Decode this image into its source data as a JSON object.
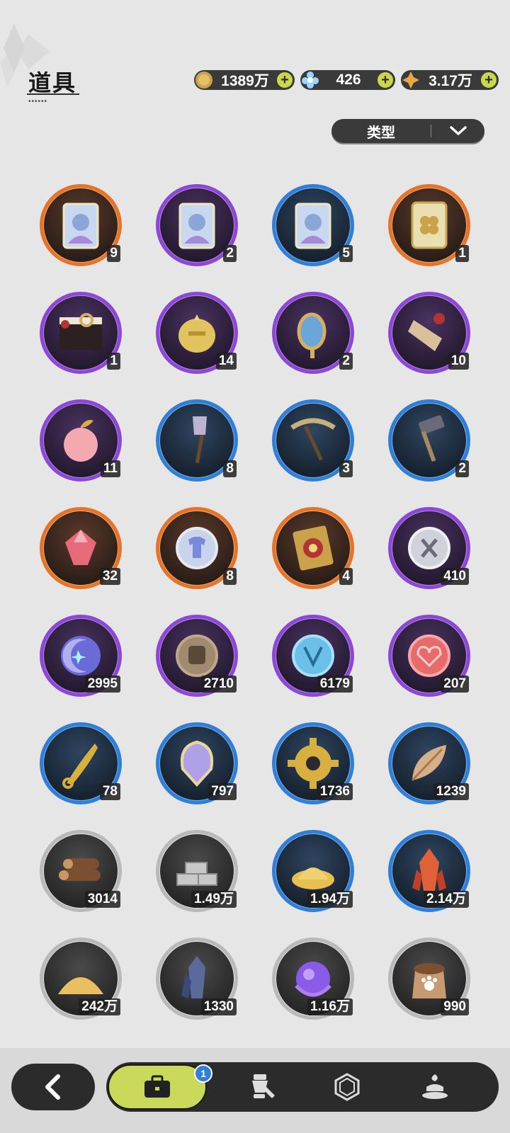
{
  "header": {
    "title": "道具",
    "currencies": [
      {
        "icon": "gold-coin-icon",
        "value": "1389万"
      },
      {
        "icon": "crystal-flower-icon",
        "value": "426"
      },
      {
        "icon": "star-gem-icon",
        "value": "3.17万"
      }
    ]
  },
  "filter": {
    "label": "类型"
  },
  "items": [
    {
      "icon": "character-card-icon",
      "count": "9",
      "rarity": "orange"
    },
    {
      "icon": "character-card-icon",
      "count": "2",
      "rarity": "purple"
    },
    {
      "icon": "character-card-icon",
      "count": "5",
      "rarity": "blue"
    },
    {
      "icon": "clover-ticket-icon",
      "count": "1",
      "rarity": "orange"
    },
    {
      "icon": "gift-box-icon",
      "count": "1",
      "rarity": "purple"
    },
    {
      "icon": "golden-helmet-icon",
      "count": "14",
      "rarity": "purple"
    },
    {
      "icon": "hand-mirror-icon",
      "count": "2",
      "rarity": "purple"
    },
    {
      "icon": "scroll-icon",
      "count": "10",
      "rarity": "purple"
    },
    {
      "icon": "apple-icon",
      "count": "11",
      "rarity": "purple"
    },
    {
      "icon": "shovel-icon",
      "count": "8",
      "rarity": "blue"
    },
    {
      "icon": "pickaxe-icon",
      "count": "3",
      "rarity": "blue"
    },
    {
      "icon": "hammer-icon",
      "count": "2",
      "rarity": "blue"
    },
    {
      "icon": "pink-gem-icon",
      "count": "32",
      "rarity": "orange"
    },
    {
      "icon": "shirt-coin-icon",
      "count": "8",
      "rarity": "orange"
    },
    {
      "icon": "lottery-ticket-icon",
      "count": "4",
      "rarity": "orange"
    },
    {
      "icon": "silver-coin-icon",
      "count": "410",
      "rarity": "purple"
    },
    {
      "icon": "moon-coin-icon",
      "count": "2995",
      "rarity": "purple"
    },
    {
      "icon": "fist-coin-icon",
      "count": "2710",
      "rarity": "purple"
    },
    {
      "icon": "blue-emblem-icon",
      "count": "6179",
      "rarity": "purple"
    },
    {
      "icon": "heart-coin-icon",
      "count": "207",
      "rarity": "purple"
    },
    {
      "icon": "golden-fang-icon",
      "count": "78",
      "rarity": "blue"
    },
    {
      "icon": "scale-shield-icon",
      "count": "797",
      "rarity": "blue"
    },
    {
      "icon": "gear-icon",
      "count": "1736",
      "rarity": "blue"
    },
    {
      "icon": "leaf-icon",
      "count": "1239",
      "rarity": "blue"
    },
    {
      "icon": "wood-logs-icon",
      "count": "3014",
      "rarity": "grey"
    },
    {
      "icon": "stone-bricks-icon",
      "count": "1.49万",
      "rarity": "grey"
    },
    {
      "icon": "gold-dust-icon",
      "count": "1.94万",
      "rarity": "blue"
    },
    {
      "icon": "red-crystal-icon",
      "count": "2.14万",
      "rarity": "blue"
    },
    {
      "icon": "sand-pile-icon",
      "count": "242万",
      "rarity": "grey"
    },
    {
      "icon": "dark-crystal-icon",
      "count": "1330",
      "rarity": "grey"
    },
    {
      "icon": "purple-orb-icon",
      "count": "1.16万",
      "rarity": "grey"
    },
    {
      "icon": "paw-sack-icon",
      "count": "990",
      "rarity": "grey"
    }
  ],
  "bottom_nav": {
    "badge": "1",
    "tabs": [
      {
        "icon": "briefcase-icon"
      },
      {
        "icon": "outfit-icon"
      },
      {
        "icon": "hexagon-gem-icon"
      },
      {
        "icon": "cake-icon"
      }
    ]
  },
  "colors": {
    "orange": "#e5742a",
    "purple": "#8c47d6",
    "blue": "#2f7fd6",
    "grey": "#b9b9b9",
    "accent": "#cbd95a"
  }
}
